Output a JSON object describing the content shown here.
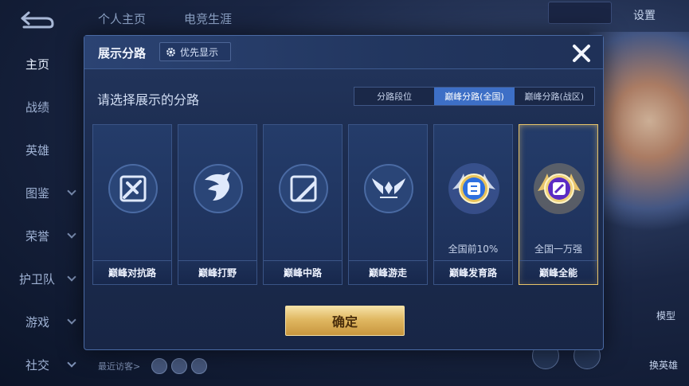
{
  "top_tabs": [
    "个人主页",
    "电竞生涯"
  ],
  "settings_label": "设置",
  "sidebar": {
    "items": [
      {
        "label": "主页",
        "active": true,
        "chevron": false
      },
      {
        "label": "战绩",
        "active": false,
        "chevron": false
      },
      {
        "label": "英雄",
        "active": false,
        "chevron": false
      },
      {
        "label": "图鉴",
        "active": false,
        "chevron": true
      },
      {
        "label": "荣誉",
        "active": false,
        "chevron": true
      },
      {
        "label": "护卫队",
        "active": false,
        "chevron": true
      },
      {
        "label": "游戏",
        "active": false,
        "chevron": true
      },
      {
        "label": "社交",
        "active": false,
        "chevron": true
      }
    ]
  },
  "recent_visitors_label": "最近访客>",
  "right_labels": {
    "model": "模型",
    "change_hero": "换英雄"
  },
  "modal": {
    "title": "展示分路",
    "priority_button": "优先显示",
    "subtitle": "请选择展示的分路",
    "tabs": [
      {
        "label": "分路段位",
        "active": false
      },
      {
        "label": "巅峰分路(全国)",
        "active": true
      },
      {
        "label": "巅峰分路(战区)",
        "active": false
      }
    ],
    "cards": [
      {
        "label": "巅峰对抗路",
        "rank": "",
        "icon": "clash-lane-icon",
        "selected": false
      },
      {
        "label": "巅峰打野",
        "rank": "",
        "icon": "jungle-dragon-icon",
        "selected": false
      },
      {
        "label": "巅峰中路",
        "rank": "",
        "icon": "mid-lane-icon",
        "selected": false
      },
      {
        "label": "巅峰游走",
        "rank": "",
        "icon": "roam-wings-icon",
        "selected": false
      },
      {
        "label": "巅峰发育路",
        "rank": "全国前10%",
        "icon": "farm-lane-badge-icon",
        "selected": false
      },
      {
        "label": "巅峰全能",
        "rank": "全国一万强",
        "icon": "all-round-badge-icon",
        "selected": true
      }
    ],
    "confirm_button": "确定"
  },
  "colors": {
    "accent_blue": "#3d6fc6",
    "gold": "#e0b862",
    "panel": "#1c2c4f"
  }
}
